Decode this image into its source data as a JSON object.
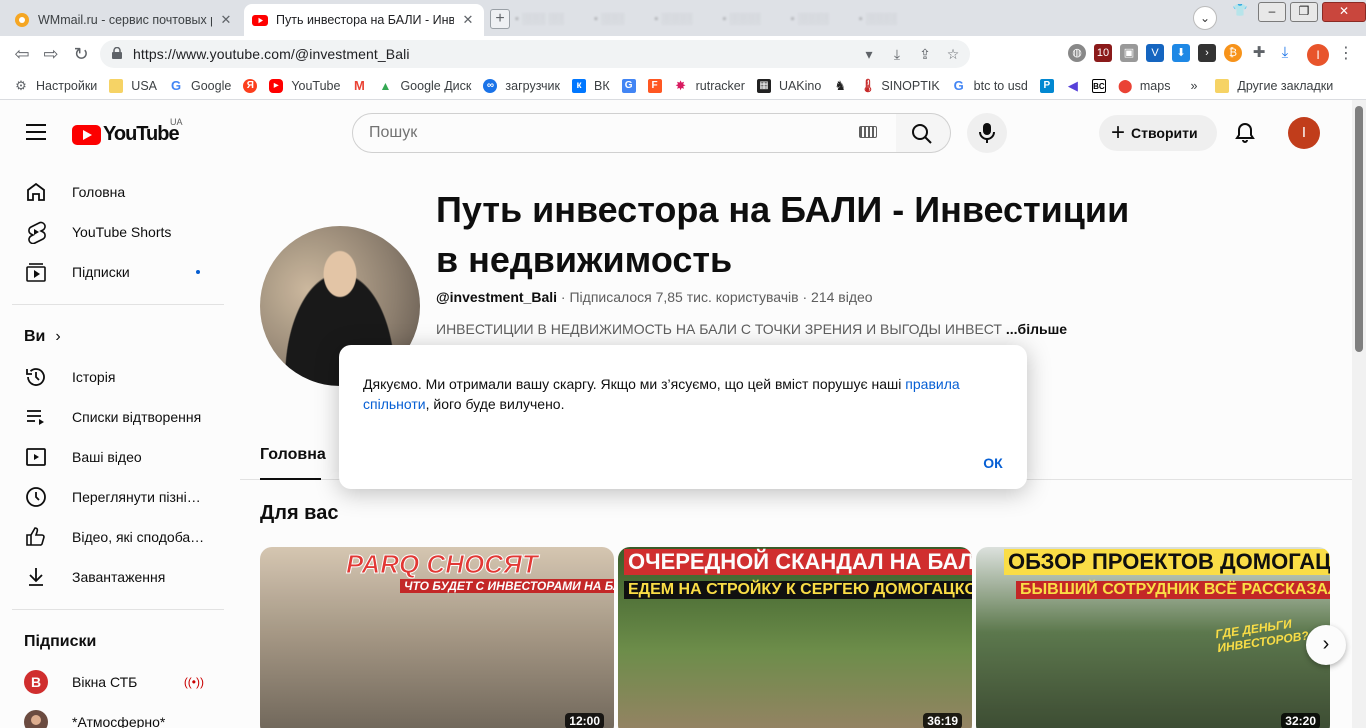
{
  "browser": {
    "tabs": [
      {
        "title": "WMmail.ru - сервис почтовых рас",
        "active": false
      },
      {
        "title": "Путь инвестора на БАЛИ - Инвес",
        "active": true
      }
    ],
    "url": "https://www.youtube.com/@investment_Bali",
    "profile_initial": "I",
    "bookmarks": [
      {
        "label": "Настройки",
        "icon": "gear-icon"
      },
      {
        "label": "USA",
        "icon": "folder-icon"
      },
      {
        "label": "Google",
        "icon": "google-icon"
      },
      {
        "label": "",
        "icon": "yandex-icon"
      },
      {
        "label": "YouTube",
        "icon": "youtube-icon"
      },
      {
        "label": "",
        "icon": "gmail-icon"
      },
      {
        "label": "Google Диск",
        "icon": "drive-icon"
      },
      {
        "label": "загрузчик",
        "icon": "infinity-icon"
      },
      {
        "label": "ВК",
        "icon": "vk-icon"
      },
      {
        "label": "",
        "icon": "translate-icon"
      },
      {
        "label": "",
        "icon": "f-icon"
      },
      {
        "label": "rutracker",
        "icon": "rutracker-icon"
      },
      {
        "label": "UAKino",
        "icon": "film-icon"
      },
      {
        "label": "",
        "icon": "chess-icon"
      },
      {
        "label": "SINOPTIK",
        "icon": "thermometer-icon"
      },
      {
        "label": "btc to usd",
        "icon": "google-icon"
      },
      {
        "label": "",
        "icon": "p-icon"
      },
      {
        "label": "",
        "icon": "kraken-icon"
      },
      {
        "label": "",
        "icon": "bc-icon"
      },
      {
        "label": "maps",
        "icon": "maps-icon"
      }
    ],
    "bookmarks_overflow": "»",
    "other_bookmarks": "Другие закладки"
  },
  "youtube": {
    "logo_text": "YouTube",
    "country_code": "UA",
    "search_placeholder": "Пошук",
    "create_label": "Створити",
    "avatar_initial": "I",
    "sidebar": {
      "main": [
        {
          "label": "Головна",
          "icon": "home-icon"
        },
        {
          "label": "YouTube Shorts",
          "icon": "shorts-icon"
        },
        {
          "label": "Підписки",
          "icon": "subscriptions-icon",
          "dot": true
        }
      ],
      "you_heading": "Ви",
      "you": [
        {
          "label": "Історія",
          "icon": "history-icon"
        },
        {
          "label": "Списки відтворення",
          "icon": "playlist-icon"
        },
        {
          "label": "Ваші відео",
          "icon": "video-icon"
        },
        {
          "label": "Переглянути пізні…",
          "icon": "clock-icon"
        },
        {
          "label": "Відео, які сподоба…",
          "icon": "like-icon"
        },
        {
          "label": "Завантаження",
          "icon": "download-icon"
        }
      ],
      "subs_heading": "Підписки",
      "subs": [
        {
          "label": "Вікна СТБ",
          "live": true
        },
        {
          "label": "*Атмосферно*",
          "live": false
        }
      ]
    },
    "channel": {
      "title": "Путь инвестора на БАЛИ - Инвестиции в недвижимость",
      "handle": "@investment_Bali",
      "subscribers": "Підписалося 7,85 тис. користувачів",
      "videos": "214 відео",
      "description": "ИНВЕСТИЦИИ В НЕДВИЖИМОСТЬ НА БАЛИ С ТОЧКИ ЗРЕНИЯ И ВЫГОДЫ ИНВЕСТ",
      "more": "...більше",
      "tab": "Головна"
    },
    "section_title": "Для вас",
    "videos": [
      {
        "overlay1": "PARQ СНОСЯТ",
        "overlay2": "ЧТО БУДЕТ С ИНВЕСТОРАМИ НА БАЛИ?",
        "duration": "12:00"
      },
      {
        "overlay1": "ОЧЕРЕДНОЙ СКАНДАЛ НА БАЛИ",
        "overlay2": "ЕДЕМ НА СТРОЙКУ К СЕРГЕЮ ДОМОГАЦКОМУ",
        "duration": "36:19"
      },
      {
        "overlay1": "ОБЗОР ПРОЕКТОВ ДОМОГАЦКОГО",
        "overlay2": "БЫВШИЙ СОТРУДНИК ВСЁ РАССКАЗАЛ",
        "overlay3": "ГДЕ ДЕНЬГИ ИНВЕСТОРОВ?",
        "duration": "32:20"
      }
    ]
  },
  "dialog": {
    "text_before": "Дякуємо. Ми отримали вашу скаргу. Якщо ми з’ясуємо, що цей вміст порушує наші ",
    "link": "правила спільноти",
    "text_after": ", його буде вилучено.",
    "ok": "ОК"
  },
  "colors": {
    "youtube_red": "#ff0000",
    "link_blue": "#065fd4",
    "avatar_orange": "#c43e1c"
  }
}
